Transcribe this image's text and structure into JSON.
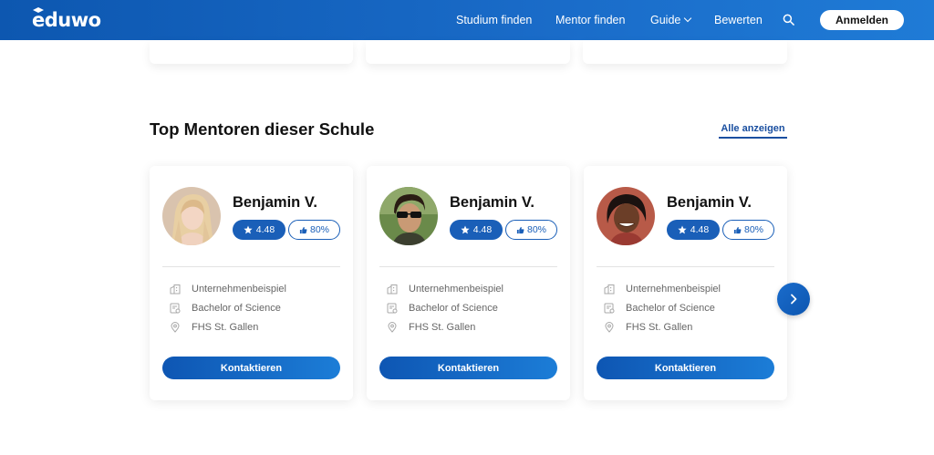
{
  "header": {
    "logo": "eduwo",
    "nav": [
      "Studium finden",
      "Mentor finden",
      "Guide",
      "Bewerten"
    ],
    "login_label": "Anmelden"
  },
  "section": {
    "title": "Top Mentoren dieser Schule",
    "see_all": "Alle anzeigen"
  },
  "mentors": [
    {
      "name": "Benjamin V.",
      "rating": "4.48",
      "recommend": "80%",
      "company": "Unternehmenbeispiel",
      "degree": "Bachelor of Science",
      "school": "FHS St. Gallen",
      "contact_label": "Kontaktieren"
    },
    {
      "name": "Benjamin V.",
      "rating": "4.48",
      "recommend": "80%",
      "company": "Unternehmenbeispiel",
      "degree": "Bachelor of Science",
      "school": "FHS St. Gallen",
      "contact_label": "Kontaktieren"
    },
    {
      "name": "Benjamin V.",
      "rating": "4.48",
      "recommend": "80%",
      "company": "Unternehmenbeispiel",
      "degree": "Bachelor of Science",
      "school": "FHS St. Gallen",
      "contact_label": "Kontaktieren"
    }
  ],
  "colors": {
    "brand": "#1a5fb8",
    "header_start": "#0d57b0",
    "header_end": "#1f7bd6"
  },
  "icons": {
    "logo_cap": "graduation-cap-icon",
    "search": "search-icon",
    "guide_dropdown": "chevron-down-icon",
    "rating": "star-icon",
    "recommend": "thumbs-up-icon",
    "company": "building-icon",
    "degree": "certificate-icon",
    "school": "location-pin-icon",
    "next": "chevron-right-icon"
  }
}
